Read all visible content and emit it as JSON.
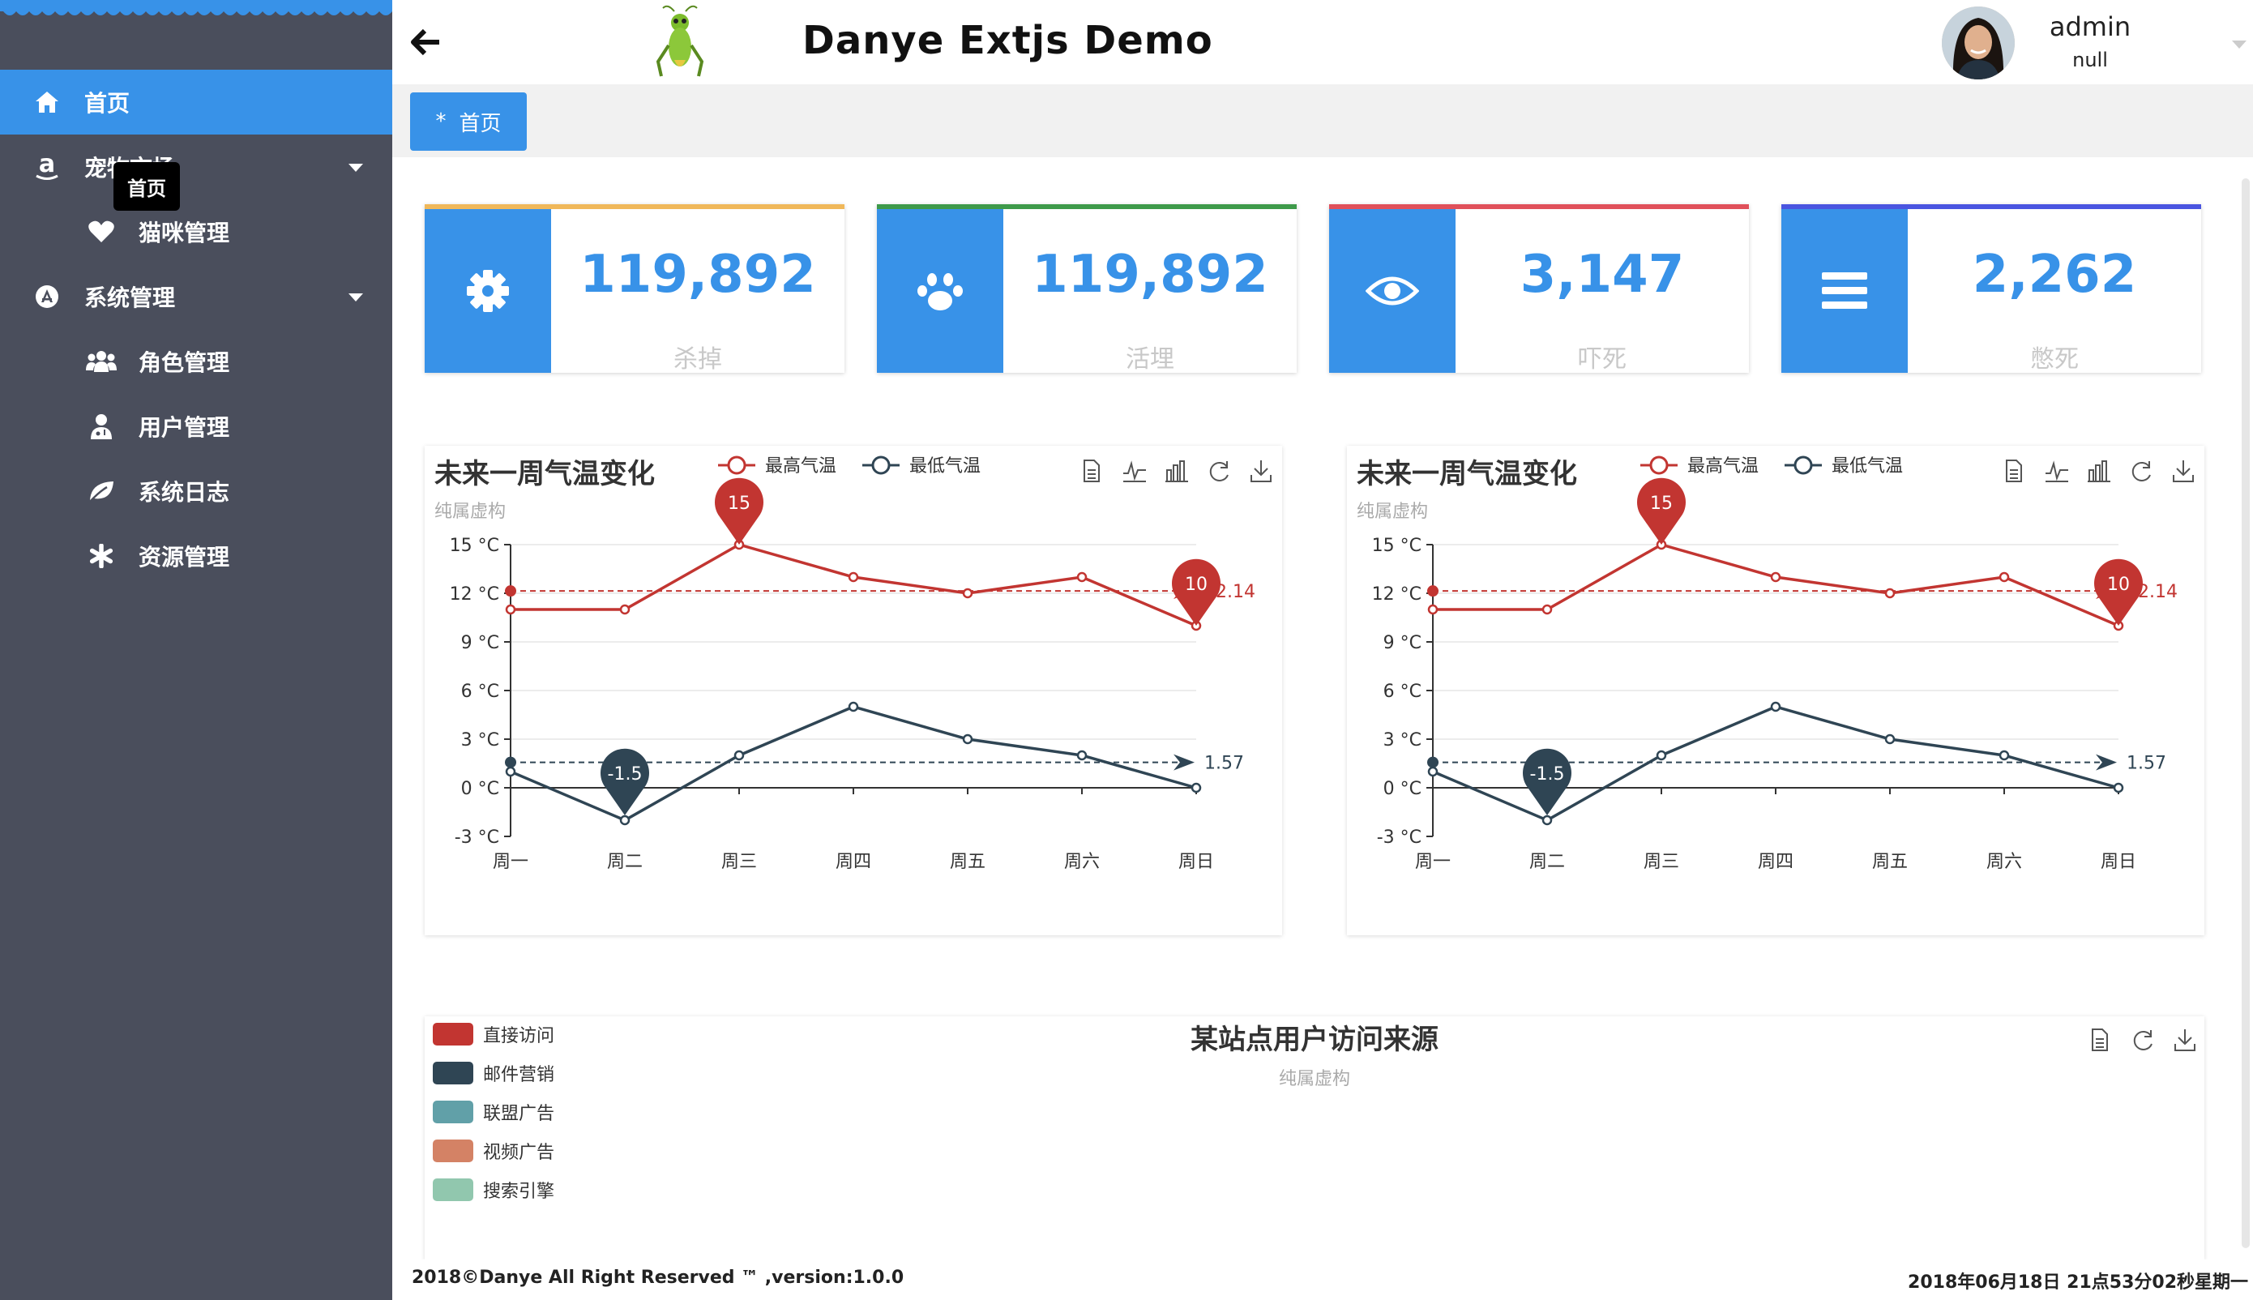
{
  "header": {
    "title": "Danye Extjs Demo",
    "user_name": "admin",
    "user_sub": "null"
  },
  "sidebar": {
    "items": [
      {
        "label": "首页",
        "icon": "home-icon",
        "level": "top",
        "active": true
      },
      {
        "label": "宠物市场",
        "icon": "amazon-icon",
        "level": "top",
        "expandable": true
      },
      {
        "label": "猫咪管理",
        "icon": "heart-icon",
        "level": "sub"
      },
      {
        "label": "系统管理",
        "icon": "app-circle-icon",
        "level": "top",
        "expandable": true
      },
      {
        "label": "角色管理",
        "icon": "users-icon",
        "level": "sub"
      },
      {
        "label": "用户管理",
        "icon": "user-md-icon",
        "level": "sub"
      },
      {
        "label": "系统日志",
        "icon": "leaf-icon",
        "level": "sub"
      },
      {
        "label": "资源管理",
        "icon": "asterisk-icon",
        "level": "sub"
      }
    ],
    "tooltip": "首页"
  },
  "tabs": [
    {
      "label": "首页",
      "icon": "asterisk-icon"
    }
  ],
  "stats": [
    {
      "value": "119,892",
      "caption": "杀掉",
      "icon": "gear-icon",
      "color": "#f0b85a"
    },
    {
      "value": "119,892",
      "caption": "活埋",
      "icon": "paw-icon",
      "color": "#3e9a4a"
    },
    {
      "value": "3,147",
      "caption": "吓死",
      "icon": "eye-icon",
      "color": "#e0505a"
    },
    {
      "value": "2,262",
      "caption": "憋死",
      "icon": "bars-icon",
      "color": "#4a55e0"
    }
  ],
  "colors": {
    "accent": "#3892e8",
    "sidebar": "#4a4e5c",
    "high": "#c23531",
    "low": "#2f4554"
  },
  "chart_data": [
    {
      "type": "line",
      "title": "未来一周气温变化",
      "subtitle": "纯属虚构",
      "categories": [
        "周一",
        "周二",
        "周三",
        "周四",
        "周五",
        "周六",
        "周日"
      ],
      "series": [
        {
          "name": "最高气温",
          "values": [
            11,
            11,
            15,
            13,
            12,
            13,
            10
          ],
          "max_label": "15",
          "min_label": "10",
          "avg_label": "12.14"
        },
        {
          "name": "最低气温",
          "values": [
            1,
            -2,
            2,
            5,
            3,
            2,
            0
          ],
          "min_label": "-1.5",
          "avg_label": "1.57"
        }
      ],
      "yticks": [
        "15 °C",
        "12 °C",
        "9 °C",
        "6 °C",
        "3 °C",
        "0 °C",
        "-3 °C"
      ],
      "ylim": [
        -3,
        15
      ],
      "legend": "top"
    },
    {
      "type": "line",
      "title": "未来一周气温变化",
      "subtitle": "纯属虚构",
      "categories": [
        "周一",
        "周二",
        "周三",
        "周四",
        "周五",
        "周六",
        "周日"
      ],
      "series": [
        {
          "name": "最高气温",
          "values": [
            11,
            11,
            15,
            13,
            12,
            13,
            10
          ],
          "max_label": "15",
          "min_label": "10",
          "avg_label": "12.14"
        },
        {
          "name": "最低气温",
          "values": [
            1,
            -2,
            2,
            5,
            3,
            2,
            0
          ],
          "min_label": "-1.5",
          "avg_label": "1.57"
        }
      ],
      "yticks": [
        "15 °C",
        "12 °C",
        "9 °C",
        "6 °C",
        "3 °C",
        "0 °C",
        "-3 °C"
      ],
      "ylim": [
        -3,
        15
      ],
      "legend": "top"
    },
    {
      "type": "pie",
      "title": "某站点用户访问来源",
      "subtitle": "纯属虚构",
      "legend_items": [
        {
          "name": "直接访问",
          "color": "#c23531"
        },
        {
          "name": "邮件营销",
          "color": "#2f4554"
        },
        {
          "name": "联盟广告",
          "color": "#61a0a8"
        },
        {
          "name": "视频广告",
          "color": "#d48265"
        },
        {
          "name": "搜索引擎",
          "color": "#91c7ae"
        }
      ],
      "legend": "left"
    }
  ],
  "footer": {
    "copyright": "2018©Danye All Right Reserved ™ ,version:1.0.0",
    "clock": "2018年06月18日 21点53分02秒星期一"
  }
}
